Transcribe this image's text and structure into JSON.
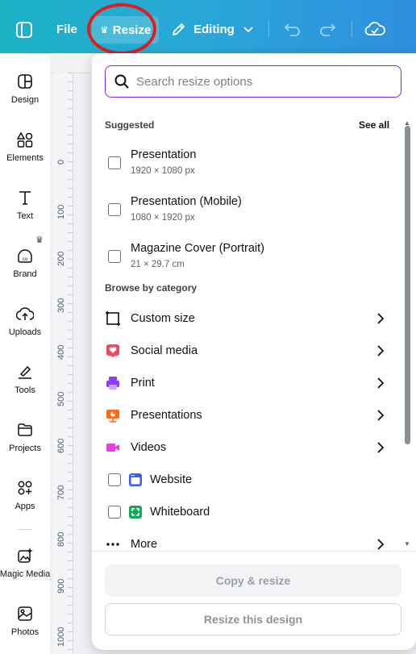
{
  "topbar": {
    "file_label": "File",
    "resize_label": "Resize",
    "editing_label": "Editing"
  },
  "sidebar": {
    "items": [
      {
        "label": "Design",
        "icon": "design-icon"
      },
      {
        "label": "Elements",
        "icon": "elements-icon"
      },
      {
        "label": "Text",
        "icon": "text-icon"
      },
      {
        "label": "Brand",
        "icon": "brand-icon"
      },
      {
        "label": "Uploads",
        "icon": "uploads-icon"
      },
      {
        "label": "Tools",
        "icon": "tools-icon"
      },
      {
        "label": "Projects",
        "icon": "projects-icon"
      },
      {
        "label": "Apps",
        "icon": "apps-icon"
      },
      {
        "label": "Magic Media",
        "icon": "magic-media-icon"
      },
      {
        "label": "Photos",
        "icon": "photos-icon"
      }
    ]
  },
  "ruler": {
    "ticks": [
      "0",
      "100",
      "200",
      "300",
      "400",
      "500",
      "600",
      "700",
      "800",
      "900",
      "1000"
    ]
  },
  "resize_panel": {
    "search_placeholder": "Search resize options",
    "suggested_title": "Suggested",
    "see_all_label": "See all",
    "suggested": [
      {
        "title": "Presentation",
        "dimensions": "1920 × 1080 px"
      },
      {
        "title": "Presentation (Mobile)",
        "dimensions": "1080 × 1920 px"
      },
      {
        "title": "Magazine Cover (Portrait)",
        "dimensions": "21 × 29.7 cm"
      }
    ],
    "browse_title": "Browse by category",
    "categories": [
      {
        "label": "Custom size",
        "icon": "custom-size-icon"
      },
      {
        "label": "Social media",
        "icon": "social-media-icon"
      },
      {
        "label": "Print",
        "icon": "print-icon"
      },
      {
        "label": "Presentations",
        "icon": "presentations-icon"
      },
      {
        "label": "Videos",
        "icon": "videos-icon"
      },
      {
        "label": "Website",
        "icon": "website-icon"
      },
      {
        "label": "Whiteboard",
        "icon": "whiteboard-icon"
      },
      {
        "label": "More",
        "icon": "more-icon"
      }
    ],
    "copy_resize_label": "Copy & resize",
    "resize_design_label": "Resize this design"
  },
  "colors": {
    "accent_purple": "#7d2ae8",
    "topbar_start": "#1bb3c6",
    "topbar_end": "#2f8fe0",
    "highlight_circle": "#e01c1c"
  }
}
